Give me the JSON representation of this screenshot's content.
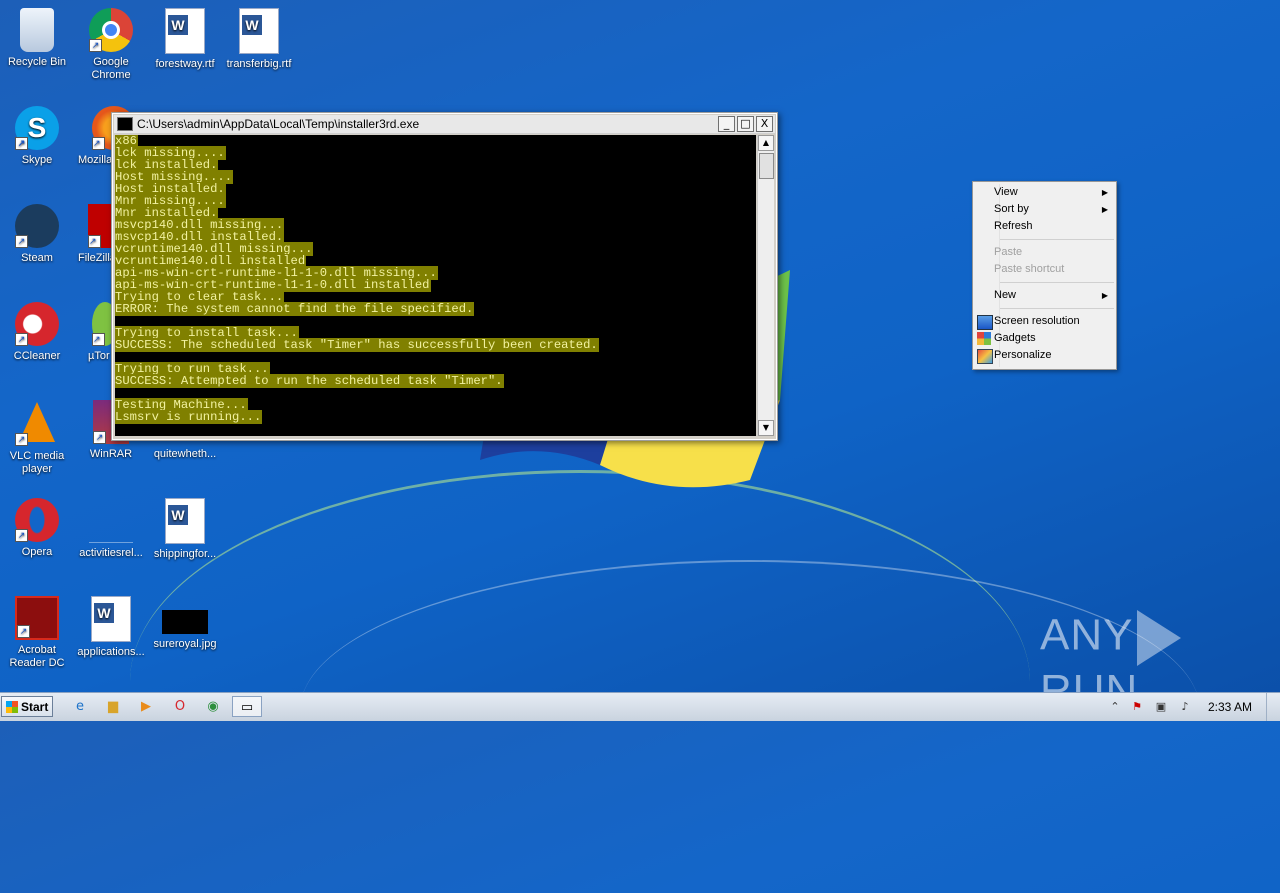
{
  "desktop": {
    "icons": [
      {
        "label": "Recycle Bin",
        "icon": "recycle-bin-icon"
      },
      {
        "label": "Google Chrome",
        "icon": "chrome-icon"
      },
      {
        "label": "forestway.rtf",
        "icon": "word-document-icon"
      },
      {
        "label": "transferbig.rtf",
        "icon": "word-document-icon"
      },
      {
        "label": "Skype",
        "icon": "skype-icon"
      },
      {
        "label": "Mozilla",
        "icon": "firefox-icon"
      },
      {
        "label": "Steam",
        "icon": "steam-icon"
      },
      {
        "label": "FileZilla",
        "icon": "filezilla-icon"
      },
      {
        "label": "CCleaner",
        "icon": "ccleaner-icon"
      },
      {
        "label": "µTor",
        "icon": "utorrent-icon"
      },
      {
        "label": "VLC media player",
        "icon": "vlc-icon"
      },
      {
        "label": "WinRAR",
        "icon": "winrar-icon"
      },
      {
        "label": "quitewheth...",
        "icon": "file-icon"
      },
      {
        "label": "Opera",
        "icon": "opera-icon"
      },
      {
        "label": "activitiesrel...",
        "icon": "file-icon"
      },
      {
        "label": "shippingfor...",
        "icon": "word-document-icon"
      },
      {
        "label": "Acrobat Reader DC",
        "icon": "acrobat-icon"
      },
      {
        "label": "applications...",
        "icon": "word-document-icon"
      },
      {
        "label": "sureroyal.jpg",
        "icon": "image-file-icon"
      }
    ],
    "watermark": {
      "left": "ANY",
      "right": "RUN"
    }
  },
  "console": {
    "title": "C:\\Users\\admin\\AppData\\Local\\Temp\\installer3rd.exe",
    "buttons": {
      "minimize": "_",
      "maximize": "□",
      "close": "X"
    },
    "lines": [
      "x86",
      "lck missing....",
      "lck installed.",
      "Host missing....",
      "Host installed.",
      "Mnr missing....",
      "Mnr installed.",
      "msvcp140.dll missing...",
      "msvcp140.dll installed.",
      "vcruntime140.dll missing...",
      "vcruntime140.dll installed",
      "api-ms-win-crt-runtime-l1-1-0.dll missing...",
      "api-ms-win-crt-runtime-l1-1-0.dll installed",
      "Trying to clear task...",
      "ERROR: The system cannot find the file specified.",
      "",
      "Trying to install task...",
      "SUCCESS: The scheduled task \"Timer\" has successfully been created.",
      "",
      "Trying to run task...",
      "SUCCESS: Attempted to run the scheduled task \"Timer\".",
      "",
      "Testing Machine...",
      "Lsmsrv is running..."
    ]
  },
  "context_menu": {
    "items": [
      {
        "label": "View",
        "submenu": true,
        "disabled": false
      },
      {
        "label": "Sort by",
        "submenu": true,
        "disabled": false
      },
      {
        "label": "Refresh",
        "submenu": false,
        "disabled": false
      },
      {
        "separator": true
      },
      {
        "label": "Paste",
        "submenu": false,
        "disabled": true
      },
      {
        "label": "Paste shortcut",
        "submenu": false,
        "disabled": true
      },
      {
        "separator": true
      },
      {
        "label": "New",
        "submenu": true,
        "disabled": false
      },
      {
        "separator": true
      },
      {
        "label": "Screen resolution",
        "icon": "screen-resolution-icon",
        "disabled": false
      },
      {
        "label": "Gadgets",
        "icon": "gadgets-icon",
        "disabled": false
      },
      {
        "label": "Personalize",
        "icon": "personalize-icon",
        "disabled": false
      }
    ]
  },
  "taskbar": {
    "start_label": "Start",
    "clock": "2:33 AM",
    "pinned": [
      "internet-explorer-icon",
      "file-explorer-icon",
      "media-player-icon",
      "opera-icon",
      "chrome-icon",
      "console-icon"
    ]
  }
}
